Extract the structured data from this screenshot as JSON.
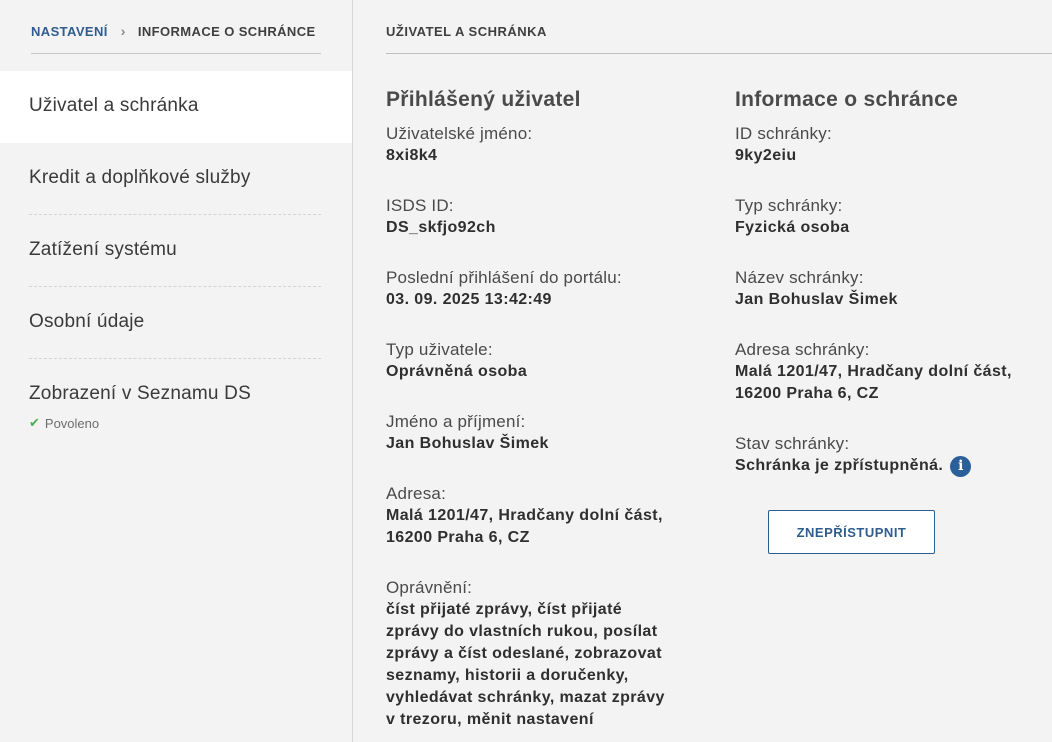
{
  "breadcrumb": {
    "root": "NASTAVENÍ",
    "current": "INFORMACE O SCHRÁNCE"
  },
  "sidebar": {
    "items": [
      {
        "label": "Uživatel a schránka",
        "active": true
      },
      {
        "label": "Kredit a doplňkové služby"
      },
      {
        "label": "Zatížení systému"
      },
      {
        "label": "Osobní údaje"
      },
      {
        "label": "Zobrazení v Seznamu DS",
        "sub": "Povoleno"
      }
    ]
  },
  "main": {
    "header": "UŽIVATEL A SCHRÁNKA",
    "user": {
      "title": "Přihlášený uživatel",
      "fields": [
        {
          "label": "Uživatelské jméno:",
          "value": "8xi8k4"
        },
        {
          "label": "ISDS ID:",
          "value": "DS_skfjo92ch"
        },
        {
          "label": "Poslední přihlášení do portálu:",
          "value": "03. 09. 2025 13:42:49"
        },
        {
          "label": "Typ uživatele:",
          "value": "Oprávněná osoba"
        },
        {
          "label": "Jméno a příjmení:",
          "value": "Jan Bohuslav Šimek"
        },
        {
          "label": "Adresa:",
          "value_lines": [
            "Malá 1201/47, Hradčany dolní část,",
            "16200 Praha 6, CZ"
          ]
        },
        {
          "label": "Oprávnění:",
          "value_lines": [
            "číst přijaté zprávy,  číst přijaté",
            "zprávy do vlastních rukou,  posílat",
            "zprávy a číst odeslané,  zobrazovat",
            "seznamy, historii a doručenky,",
            "vyhledávat schránky,  mazat zprávy",
            "v trezoru,  měnit nastavení"
          ]
        }
      ]
    },
    "box": {
      "title": "Informace o schránce",
      "fields": [
        {
          "label": "ID schránky:",
          "value": "9ky2eiu"
        },
        {
          "label": "Typ schránky:",
          "value": "Fyzická osoba"
        },
        {
          "label": "Název schránky:",
          "value": "Jan Bohuslav Šimek"
        },
        {
          "label": "Adresa schránky:",
          "value_lines": [
            "Malá 1201/47, Hradčany dolní část,",
            "16200 Praha 6, CZ"
          ]
        },
        {
          "label": "Stav schránky:",
          "value": "Schránka je zpřístupněná."
        }
      ],
      "button": "ZNEPŘÍSTUPNIT"
    }
  },
  "colors": {
    "accent": "#2f5d8f",
    "check": "#4caf50",
    "info_icon": "#2a5f9a"
  },
  "icons": {
    "breadcrumb_separator": "chevron-right-icon",
    "enabled": "check-icon",
    "status_info": "info-icon"
  }
}
